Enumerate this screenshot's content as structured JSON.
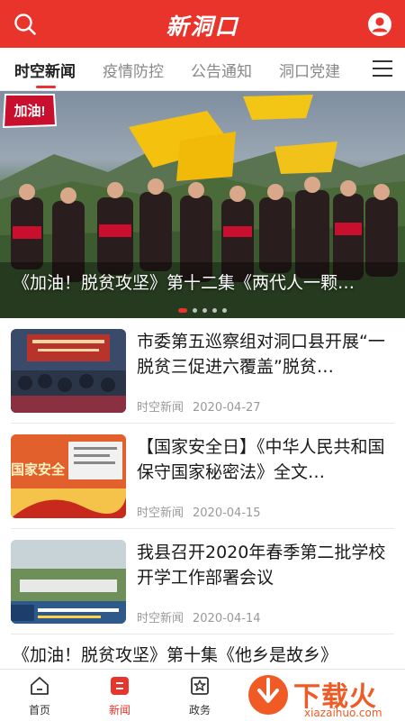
{
  "header": {
    "logo_text": "新洞口",
    "brand_color": "#e8342a",
    "icons": [
      "search-icon",
      "user-icon"
    ]
  },
  "tabs": [
    {
      "label": "时空新闻",
      "active": true
    },
    {
      "label": "疫情防控",
      "active": false
    },
    {
      "label": "公告通知",
      "active": false
    },
    {
      "label": "洞口党建",
      "active": false
    }
  ],
  "hero": {
    "title": "《加油！脱贫攻坚》第十二集《两代人一颗…",
    "badge_text": "加油!",
    "slide_count": 5,
    "active_slide": 1
  },
  "news": [
    {
      "title": "市委第五巡察组对洞口县开展“一脱贫三促进六覆盖”脱贫…",
      "source": "时空新闻",
      "date": "2020-04-27"
    },
    {
      "title": "【国家安全日】《中华人民共和国保守国家秘密法》全文…",
      "source": "时空新闻",
      "date": "2020-04-15",
      "thumb_text": "国家安全"
    },
    {
      "title": "我县召开2020年春季第二批学校开学工作部署会议",
      "source": "时空新闻",
      "date": "2020-04-14"
    }
  ],
  "partial_item": {
    "title": "《加油！脱贫攻坚》第十集《他乡是故乡》"
  },
  "bottom_nav": [
    {
      "label": "首页",
      "icon": "home-icon",
      "active": false
    },
    {
      "label": "新闻",
      "icon": "news-icon",
      "active": true
    },
    {
      "label": "政务",
      "icon": "government-icon",
      "active": false
    }
  ],
  "watermark": {
    "text": "下载火",
    "sub": "xiazaihuo.com"
  }
}
